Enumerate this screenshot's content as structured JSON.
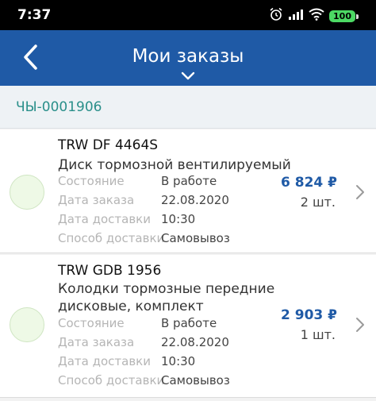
{
  "status_bar": {
    "time": "7:37",
    "battery": "100",
    "icons": [
      "alarm-icon",
      "signal-icon",
      "wifi-icon",
      "battery-icon"
    ]
  },
  "header": {
    "title": "Мои заказы",
    "background": "#1f5aa6"
  },
  "order": {
    "number": "ЧЫ-0001906"
  },
  "labels": {
    "state": "Состояние",
    "order_date": "Дата заказа",
    "delivery_date": "Дата доставки",
    "delivery_method": "Способ доставки"
  },
  "items": [
    {
      "sku": "TRW DF 4464S",
      "description": "Диск тормозной вентилируемый",
      "state": "В работе",
      "order_date": "22.08.2020",
      "delivery_date": "10:30",
      "delivery_method": "Самовывоз",
      "price": "6 824 ₽",
      "quantity": "2 шт."
    },
    {
      "sku": "TRW GDB 1956",
      "description_line1": "Колодки тормозные передние",
      "description_line2": "дисковые, комплект",
      "state": "В работе",
      "order_date": "22.08.2020",
      "delivery_date": "10:30",
      "delivery_method": "Самовывоз",
      "price": "2 903 ₽",
      "quantity": "1 шт."
    }
  ]
}
